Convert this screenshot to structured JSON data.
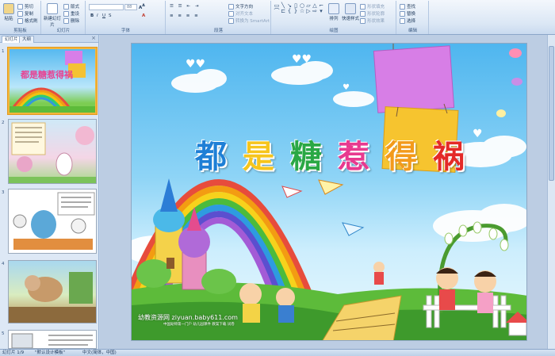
{
  "ribbon": {
    "groups": [
      {
        "label": "剪贴板",
        "items": [
          "粘贴",
          "剪切",
          "复制",
          "格式刷"
        ]
      },
      {
        "label": "幻灯片",
        "items": [
          "新建幻灯片",
          "版式",
          "重设",
          "删除"
        ]
      },
      {
        "label": "字体",
        "font_size": "88"
      },
      {
        "label": "段落",
        "items": [
          "文字方向",
          "对齐文本",
          "转换为 SmartArt"
        ]
      },
      {
        "label": "绘图",
        "items": [
          "排列",
          "快速样式",
          "形状填充",
          "形状轮廓",
          "形状效果"
        ]
      },
      {
        "label": "编辑",
        "items": [
          "查找",
          "替换",
          "选择"
        ]
      }
    ]
  },
  "pane": {
    "tabs": [
      "幻灯片",
      "大纲"
    ],
    "close": "×",
    "slide_numbers": [
      "1",
      "2",
      "3",
      "4",
      "5"
    ]
  },
  "slide": {
    "title_chars": [
      {
        "ch": "都",
        "color": "#1e7fd6"
      },
      {
        "ch": "是",
        "color": "#f6c51c"
      },
      {
        "ch": "糖",
        "color": "#2aa845"
      },
      {
        "ch": "惹",
        "color": "#e83a8f"
      },
      {
        "ch": "得",
        "color": "#f39a1b"
      },
      {
        "ch": "祸",
        "color": "#e42a27"
      }
    ],
    "watermark": "幼教资源网 ziyuan.baby611.com",
    "watermark_sub": "中国幼师第一门户  幼儿园课件  教案下载  试卷",
    "thumb_title": "都是糖惹得祸"
  },
  "status": {
    "slide_info": "幻灯片 1/9",
    "theme": "\"默认设计模板\"",
    "language": "中文(简体，中国)"
  },
  "colors": {
    "accent": "#f3b53a",
    "ribbon": "#dbe7f5",
    "sky": "#4fb6ef",
    "grass": "#5dbb3a"
  }
}
